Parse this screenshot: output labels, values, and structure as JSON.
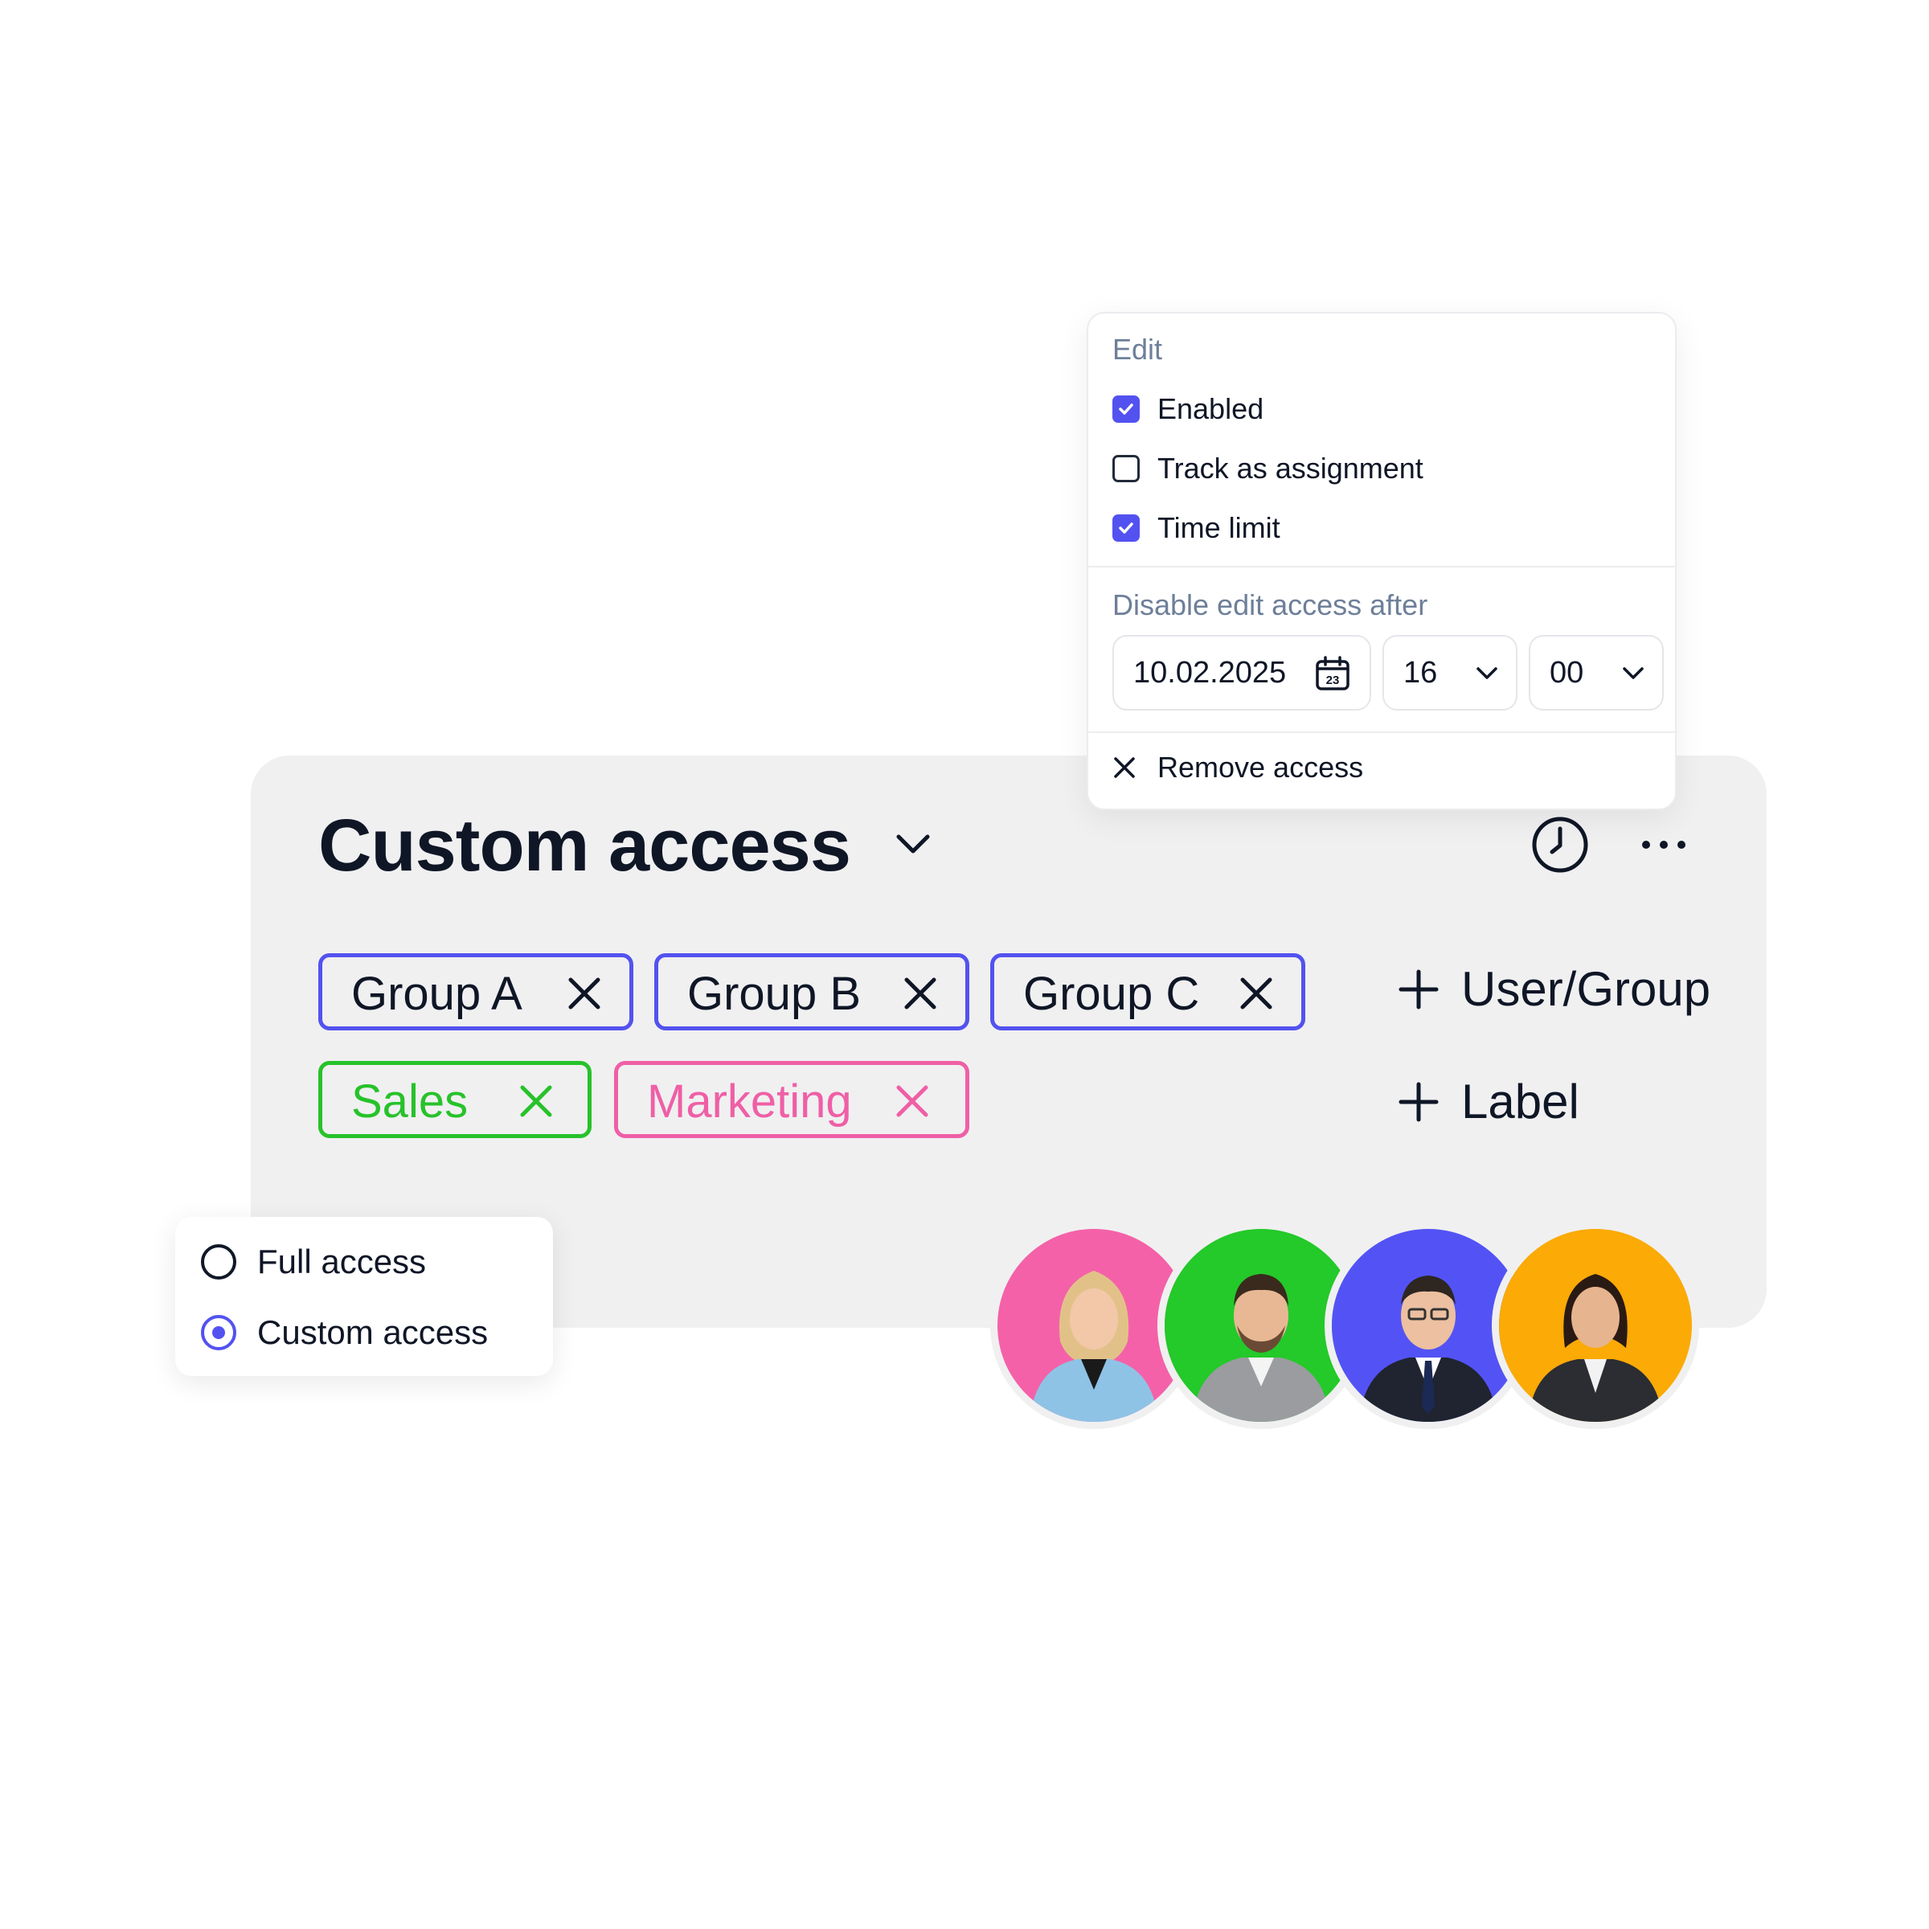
{
  "edit_popover": {
    "heading": "Edit",
    "options": [
      {
        "label": "Enabled",
        "checked": true
      },
      {
        "label": "Track as assignment",
        "checked": false
      },
      {
        "label": "Time limit",
        "checked": true
      }
    ],
    "time_limit_heading": "Disable edit access after",
    "date_value": "10.02.2025",
    "calendar_icon_day": "23",
    "hour_value": "16",
    "minute_value": "00",
    "remove_label": "Remove access"
  },
  "access_card": {
    "title": "Custom access",
    "groups": [
      {
        "label": "Group A"
      },
      {
        "label": "Group B"
      },
      {
        "label": "Group C"
      }
    ],
    "labels": [
      {
        "label": "Sales",
        "color": "#27c22a"
      },
      {
        "label": "Marketing",
        "color": "#ef5fa6"
      }
    ],
    "add_user_group": "User/Group",
    "add_label": "Label",
    "accent_color": "#5352f0"
  },
  "access_type": {
    "options": [
      {
        "label": "Full access",
        "selected": false
      },
      {
        "label": "Custom access",
        "selected": true
      }
    ]
  },
  "avatars": [
    {
      "color": "#f461a8",
      "icon": "person-woman-blonde"
    },
    {
      "color": "#24c92a",
      "icon": "person-man-beard"
    },
    {
      "color": "#5353f5",
      "icon": "person-man-glasses"
    },
    {
      "color": "#fbaa06",
      "icon": "person-woman-dark-hair"
    }
  ]
}
